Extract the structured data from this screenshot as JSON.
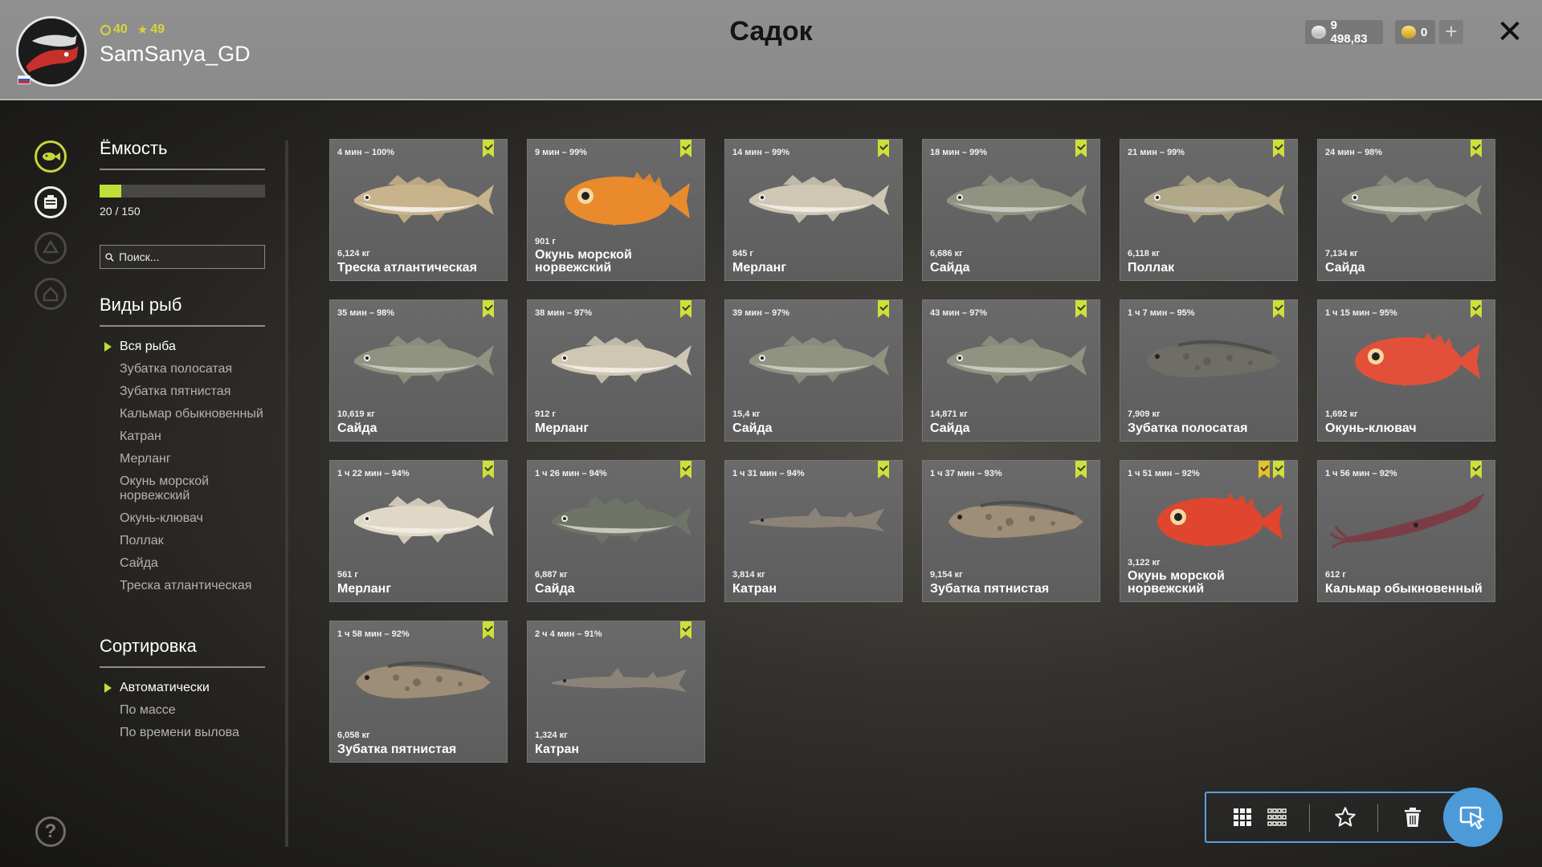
{
  "header": {
    "title": "Садок",
    "username": "SamSanya_GD",
    "level": "40",
    "rating": "49",
    "silver": "9 498,83",
    "gold": "0"
  },
  "sidebar": {
    "capacity_title": "Ёмкость",
    "capacity_text": "20 / 150",
    "capacity_fraction": 0.1333,
    "search_placeholder": "Поиск...",
    "species_title": "Виды рыб",
    "species": [
      "Вся рыба",
      "Зубатка полосатая",
      "Зубатка пятнистая",
      "Кальмар обыкновенный",
      "Катран",
      "Мерланг",
      "Окунь морской норвежский",
      "Окунь-клювач",
      "Поллак",
      "Сайда",
      "Треска атлантическая"
    ],
    "species_selected": 0,
    "sort_title": "Сортировка",
    "sort": [
      "Автоматически",
      "По массе",
      "По времени вылова"
    ],
    "sort_selected": 0
  },
  "fish": [
    {
      "time": "4 мин – 100%",
      "weight": "6,124 кг",
      "name": "Треска атлантическая",
      "kind": "cod",
      "color": "#c9b38c"
    },
    {
      "time": "9 мин – 99%",
      "weight": "901 г",
      "name": "Окунь морской норвежский",
      "kind": "redfish",
      "color": "#e98a2c"
    },
    {
      "time": "14 мин – 99%",
      "weight": "845 г",
      "name": "Мерланг",
      "kind": "whiting",
      "color": "#cfc6b3"
    },
    {
      "time": "18 мин – 99%",
      "weight": "6,686 кг",
      "name": "Сайда",
      "kind": "saithe",
      "color": "#8f9380"
    },
    {
      "time": "21 мин – 99%",
      "weight": "6,118 кг",
      "name": "Поллак",
      "kind": "saithe",
      "color": "#b0a887"
    },
    {
      "time": "24 мин – 98%",
      "weight": "7,134 кг",
      "name": "Сайда",
      "kind": "saithe",
      "color": "#8f9380"
    },
    {
      "time": "35 мин – 98%",
      "weight": "10,619 кг",
      "name": "Сайда",
      "kind": "saithe",
      "color": "#8f9380"
    },
    {
      "time": "38 мин – 97%",
      "weight": "912 г",
      "name": "Мерланг",
      "kind": "whiting",
      "color": "#cfc6b3"
    },
    {
      "time": "39 мин – 97%",
      "weight": "15,4 кг",
      "name": "Сайда",
      "kind": "saithe",
      "color": "#8f9380"
    },
    {
      "time": "43 мин – 97%",
      "weight": "14,871 кг",
      "name": "Сайда",
      "kind": "saithe",
      "color": "#8f9380"
    },
    {
      "time": "1 ч 7 мин – 95%",
      "weight": "7,909 кг",
      "name": "Зубатка полосатая",
      "kind": "wolffish",
      "color": "#6f6e66"
    },
    {
      "time": "1 ч 15 мин – 95%",
      "weight": "1,692 кг",
      "name": "Окунь-клювач",
      "kind": "redfish",
      "color": "#e2503a"
    },
    {
      "time": "1 ч 22 мин – 94%",
      "weight": "561 г",
      "name": "Мерланг",
      "kind": "whiting",
      "color": "#e0d8c6"
    },
    {
      "time": "1 ч 26 мин – 94%",
      "weight": "6,887 кг",
      "name": "Сайда",
      "kind": "saithe",
      "color": "#6f7566"
    },
    {
      "time": "1 ч 31 мин – 94%",
      "weight": "3,814 кг",
      "name": "Катран",
      "kind": "shark",
      "color": "#8b8378"
    },
    {
      "time": "1 ч 37 мин – 93%",
      "weight": "9,154 кг",
      "name": "Зубатка пятнистая",
      "kind": "wolffish",
      "color": "#9e8e78"
    },
    {
      "time": "1 ч 51 мин – 92%",
      "weight": "3,122 кг",
      "name": "Окунь морской норвежский",
      "kind": "redfish",
      "color": "#e0452f",
      "gold_mark": true
    },
    {
      "time": "1 ч 56 мин – 92%",
      "weight": "612 г",
      "name": "Кальмар обыкновенный",
      "kind": "squid",
      "color": "#7a3d46"
    },
    {
      "time": "1 ч 58 мин – 92%",
      "weight": "6,058 кг",
      "name": "Зубатка пятнистая",
      "kind": "wolffish",
      "color": "#9e8e78"
    },
    {
      "time": "2 ч 4 мин – 91%",
      "weight": "1,324 кг",
      "name": "Катран",
      "kind": "shark",
      "color": "#8b8378"
    }
  ],
  "toolbar": {
    "icons": [
      "grid-large-icon",
      "grid-small-icon",
      "star-icon",
      "trash-icon",
      "cursor-select-icon"
    ]
  },
  "colors": {
    "accent": "#bfe038",
    "toolbar_border": "#56a0e6",
    "header_bg": "#8c8c8c"
  }
}
